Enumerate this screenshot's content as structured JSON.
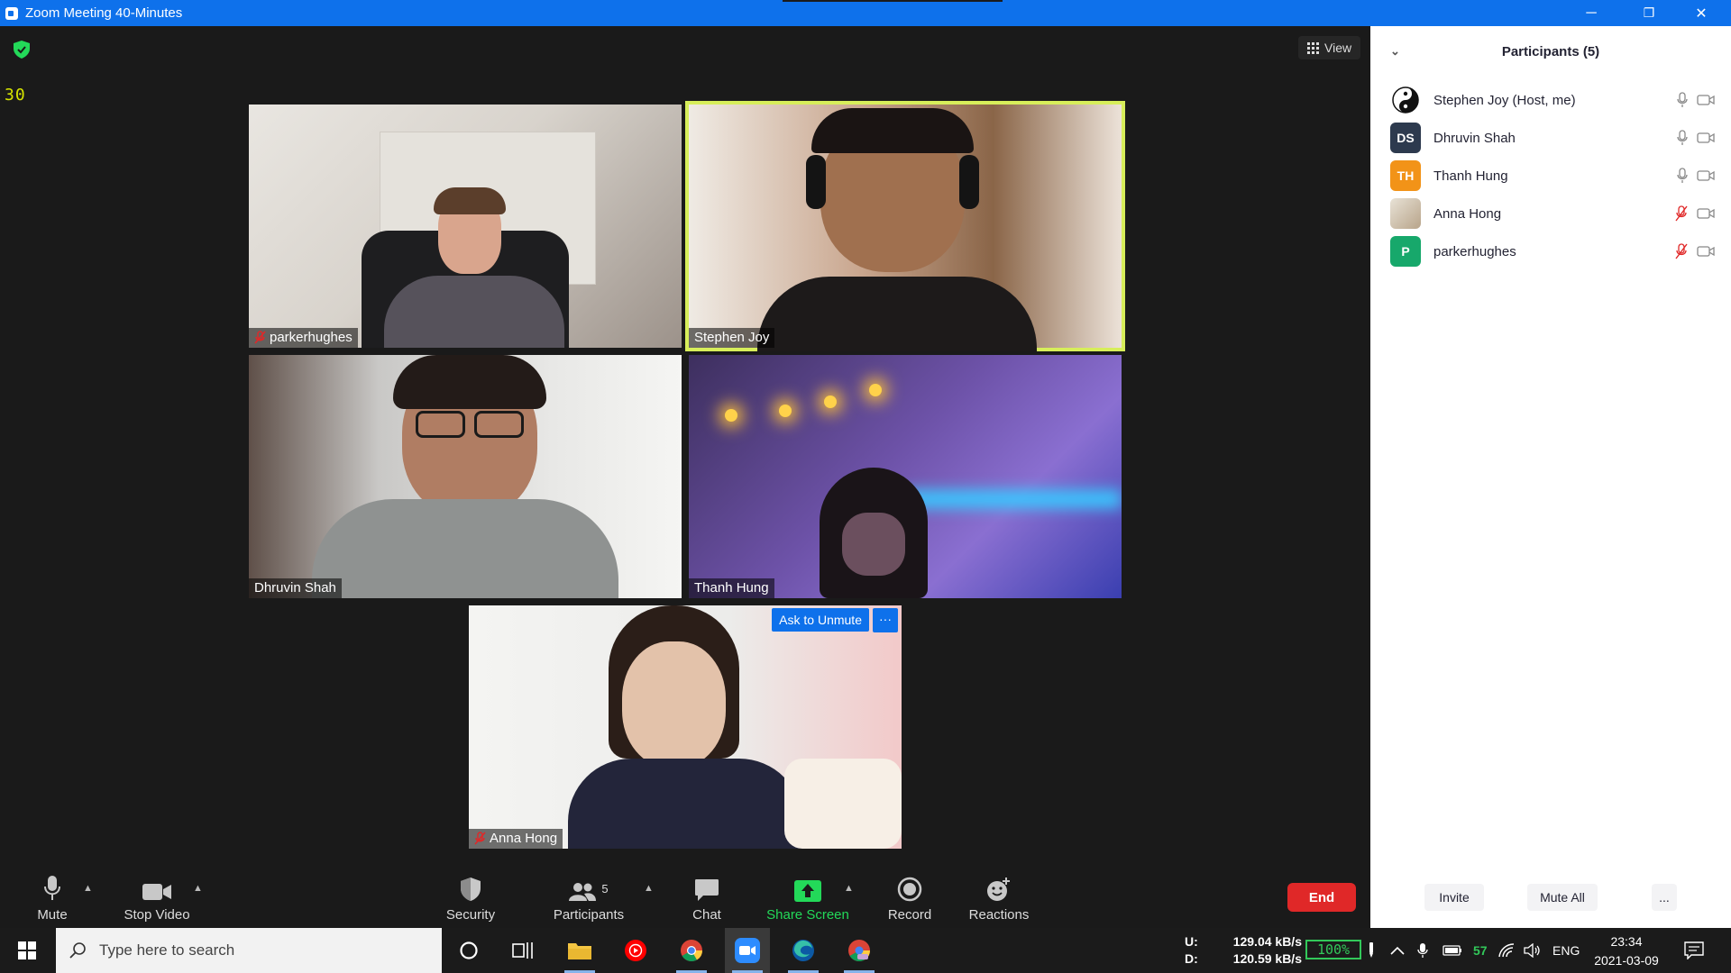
{
  "window": {
    "title": "Zoom Meeting 40-Minutes",
    "minimize": "─",
    "restore": "❐",
    "close": "✕"
  },
  "stage": {
    "fps": "30",
    "view_label": "View"
  },
  "tiles": [
    {
      "name": "parkerhughes",
      "muted": true
    },
    {
      "name": "Stephen Joy",
      "muted": false,
      "speaking": true
    },
    {
      "name": "Dhruvin Shah",
      "muted": false
    },
    {
      "name": "Thanh Hung",
      "muted": false
    },
    {
      "name": "Anna Hong",
      "muted": true,
      "ask_unmute": "Ask to Unmute",
      "more": "···"
    }
  ],
  "toolbar": {
    "mute": "Mute",
    "stop_video": "Stop Video",
    "security": "Security",
    "participants": "Participants",
    "participants_count": "5",
    "chat": "Chat",
    "share_screen": "Share Screen",
    "record": "Record",
    "reactions": "Reactions",
    "end": "End"
  },
  "panel": {
    "title": "Participants (5)",
    "participants": [
      {
        "name": "Stephen Joy (Host, me)",
        "initials": "",
        "color": "#ffffff",
        "mic_muted": false
      },
      {
        "name": "Dhruvin Shah",
        "initials": "DS",
        "color": "#2d3a4e",
        "mic_muted": false
      },
      {
        "name": "Thanh Hung",
        "initials": "TH",
        "color": "#f29318",
        "mic_muted": false
      },
      {
        "name": "Anna Hong",
        "initials": "",
        "color": "#d9cdb8",
        "mic_muted": true
      },
      {
        "name": "parkerhughes",
        "initials": "P",
        "color": "#17a86b",
        "mic_muted": true
      }
    ],
    "invite": "Invite",
    "mute_all": "Mute All",
    "more": "..."
  },
  "taskbar": {
    "search_placeholder": "Type here to search",
    "net_up_label": "U:",
    "net_down_label": "D:",
    "net_up": "129.04 kB/s",
    "net_down": "120.59 kB/s",
    "battery": "100%",
    "tray_number": "57",
    "language": "ENG",
    "time": "23:34",
    "date": "2021-03-09"
  },
  "colors": {
    "zoom_blue": "#0e71eb",
    "speaking_border": "#d7ee5a",
    "end_red": "#e02828",
    "share_green": "#23d959",
    "muted_red": "#e02828"
  }
}
